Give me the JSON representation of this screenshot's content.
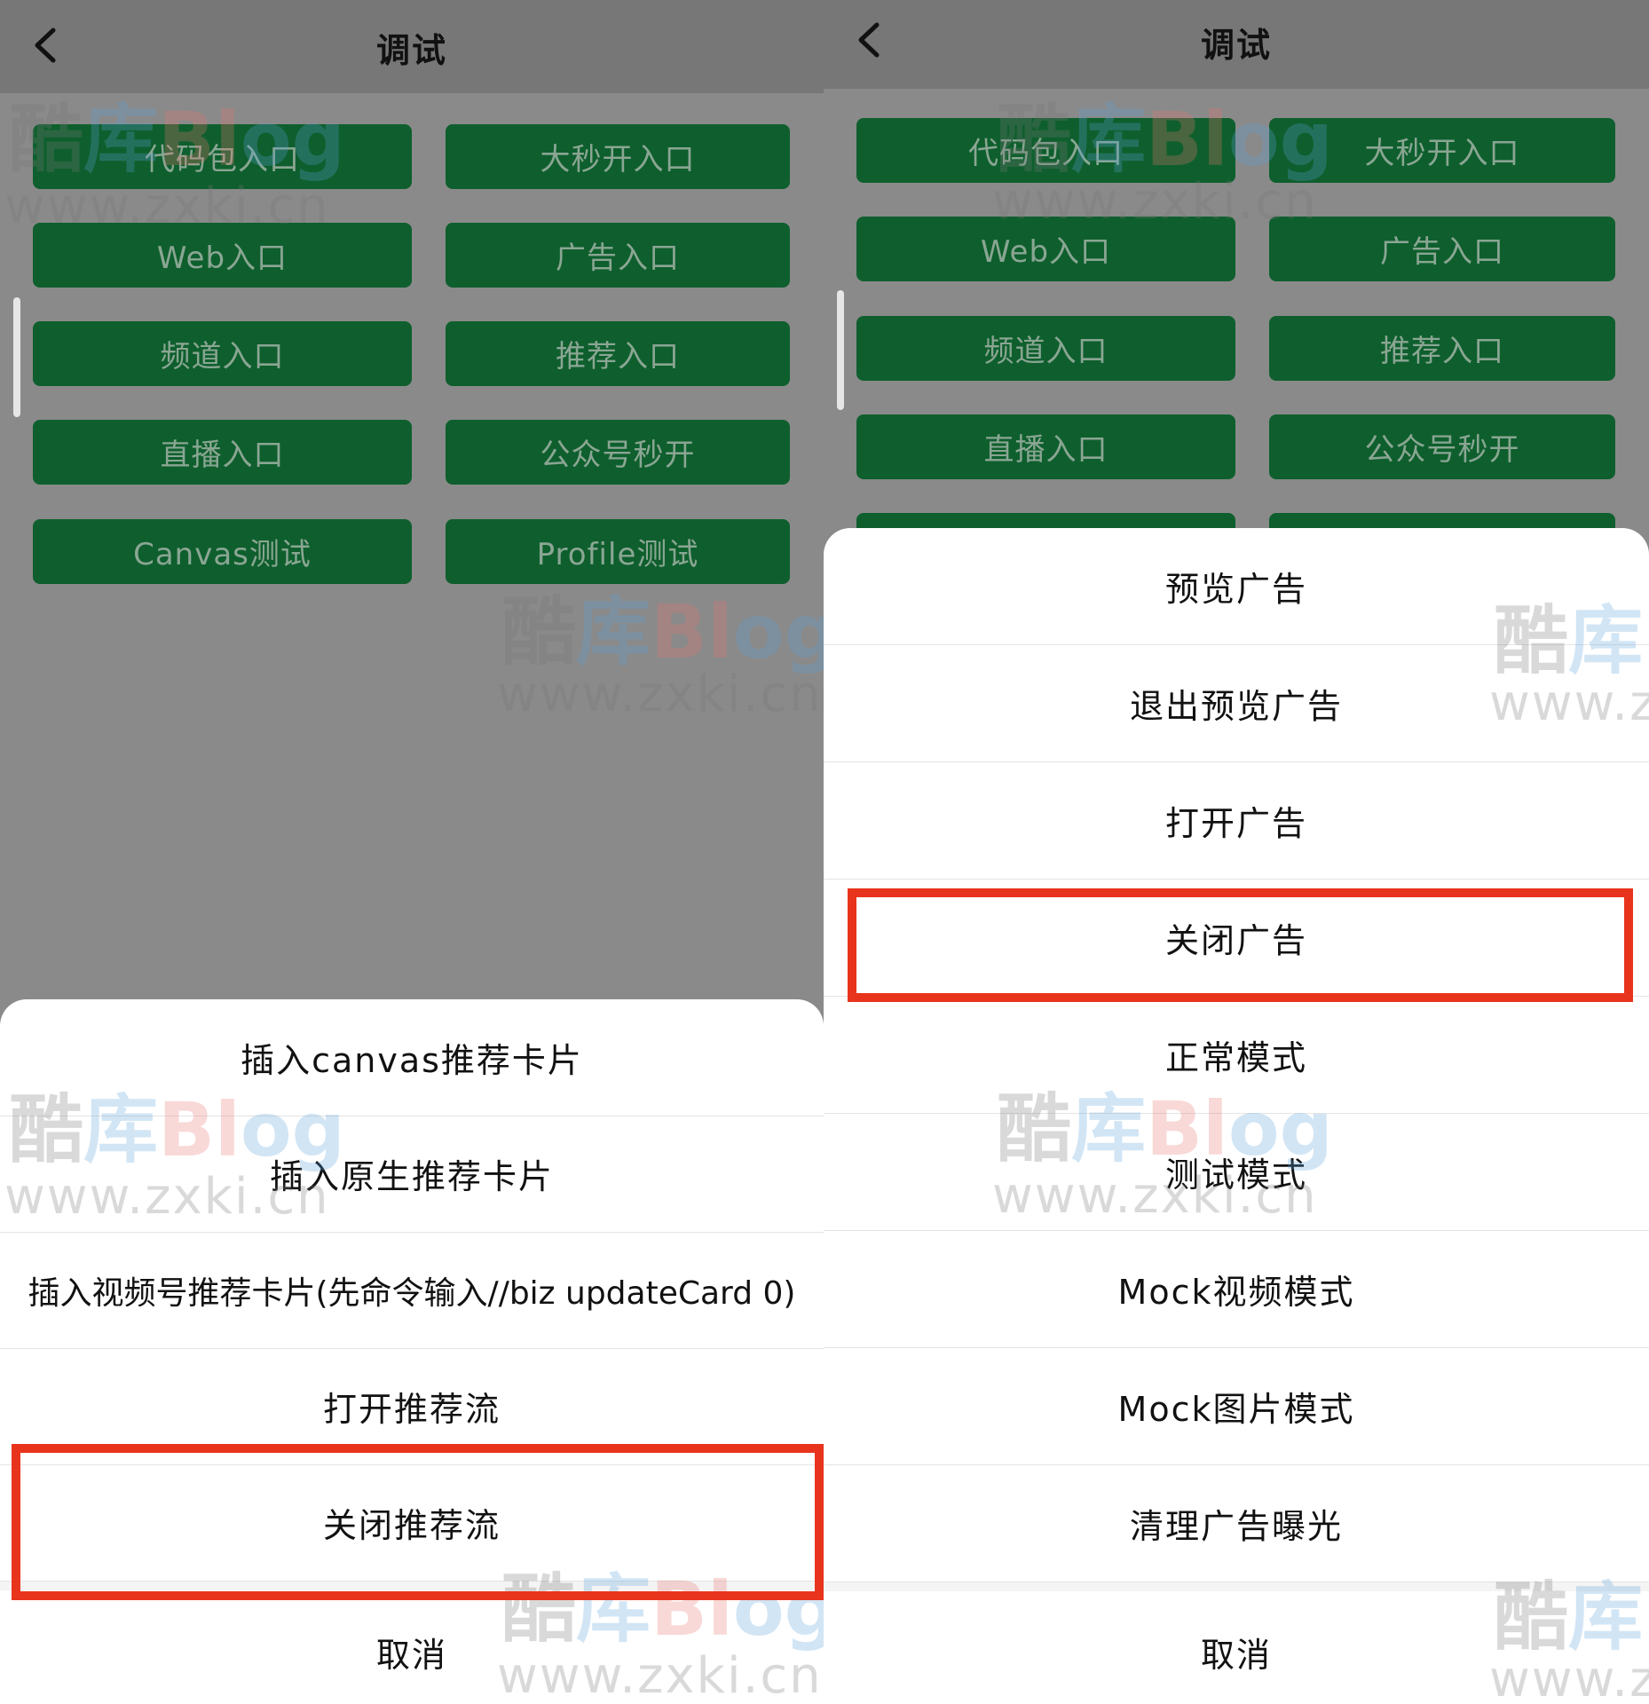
{
  "left": {
    "title": "调试",
    "grid_buttons": [
      "代码包入口",
      "大秒开入口",
      "Web入口",
      "广告入口",
      "频道入口",
      "推荐入口",
      "直播入口",
      "公众号秒开",
      "Canvas测试",
      "Profile测试"
    ],
    "sheet_items": [
      "插入canvas推荐卡片",
      "插入原生推荐卡片",
      "插入视频号推荐卡片(先命令输入//biz updateCard 0)",
      "打开推荐流",
      "关闭推荐流"
    ],
    "highlighted_item": "关闭推荐流",
    "cancel": "取消"
  },
  "right": {
    "title": "调试",
    "grid_buttons": [
      "代码包入口",
      "大秒开入口",
      "Web入口",
      "广告入口",
      "频道入口",
      "推荐入口",
      "直播入口",
      "公众号秒开"
    ],
    "sheet_items": [
      "预览广告",
      "退出预览广告",
      "打开广告",
      "关闭广告",
      "正常模式",
      "测试模式",
      "Mock视频模式",
      "Mock图片模式",
      "清理广告曝光"
    ],
    "highlighted_item": "关闭广告",
    "cancel": "取消"
  },
  "watermark": {
    "logo": "酷库Blog",
    "logo_parts": [
      "酷",
      "库",
      "Bl",
      "og"
    ],
    "url": "www.zxki.cn"
  },
  "colors": {
    "button_green": "#0e5f2d",
    "highlight_red": "#e8341c",
    "overlay_gray": "#8a8a8a"
  },
  "icons": {
    "back": "chevron-left-icon"
  }
}
